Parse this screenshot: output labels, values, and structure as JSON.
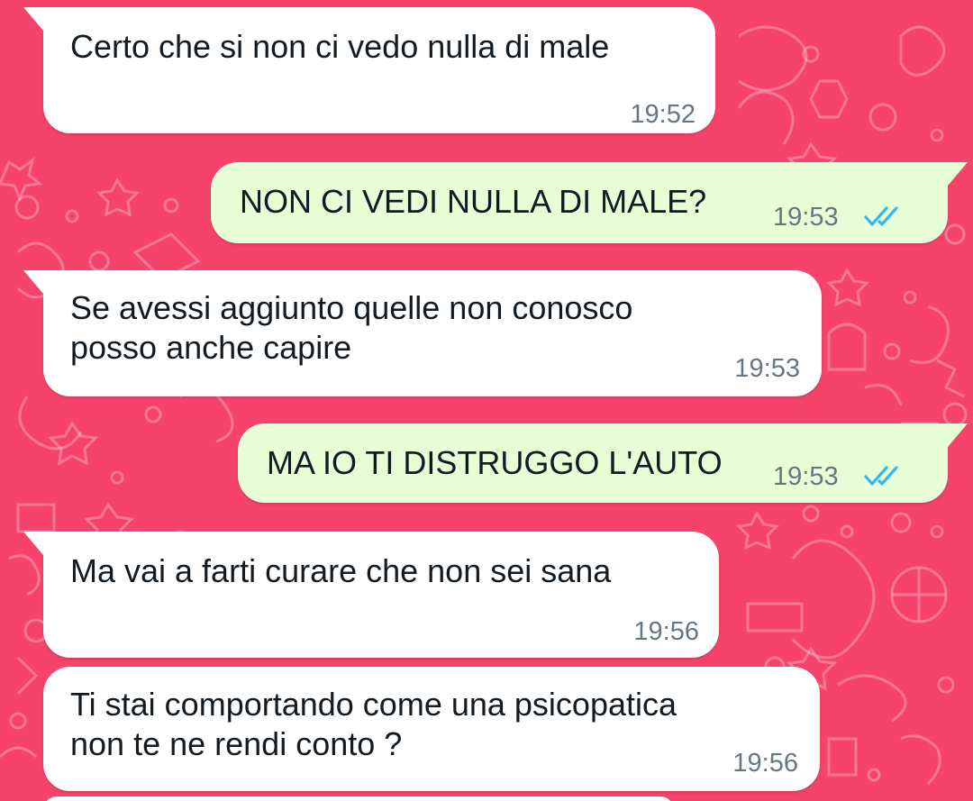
{
  "colors": {
    "background": "#f5436b",
    "incoming_bubble": "#ffffff",
    "outgoing_bubble": "#e7fed6",
    "read_ticks": "#34b7f1"
  },
  "messages": [
    {
      "direction": "incoming",
      "text": "Certo che si non ci vedo nulla di male",
      "time": "19:52"
    },
    {
      "direction": "outgoing",
      "text": "NON CI VEDI NULLA DI MALE?",
      "time": "19:53",
      "status": "read",
      "status_icon": "double-check-icon"
    },
    {
      "direction": "incoming",
      "text": "Se avessi aggiunto quelle non conosco\nposso anche capire",
      "time": "19:53"
    },
    {
      "direction": "outgoing",
      "text": "MA IO TI DISTRUGGO L'AUTO",
      "time": "19:53",
      "status": "read",
      "status_icon": "double-check-icon"
    },
    {
      "direction": "incoming",
      "text": "Ma vai a farti curare che non sei sana",
      "time": "19:56"
    },
    {
      "direction": "incoming",
      "text": "Ti stai comportando come una psicopatica\nnon te ne rendi conto ?",
      "time": "19:56"
    }
  ]
}
